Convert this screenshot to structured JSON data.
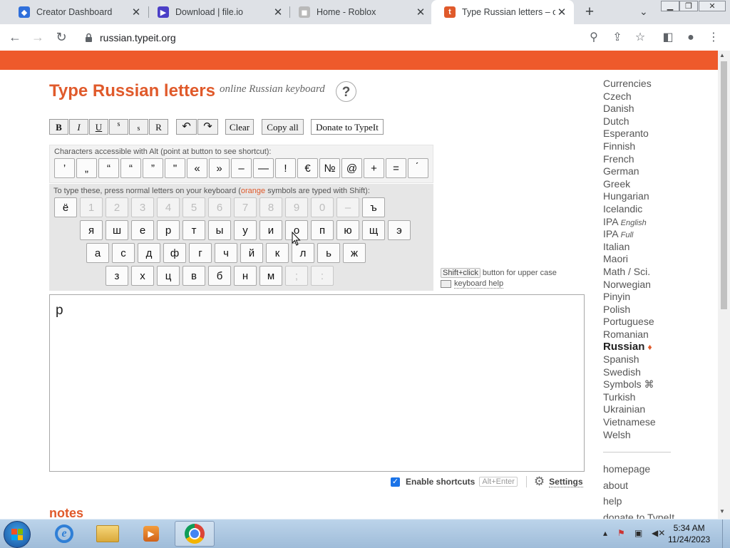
{
  "browser": {
    "tabs": [
      {
        "title": "Creator Dashboard",
        "favicon_color": "#2f6fdb"
      },
      {
        "title": "Download | file.io",
        "favicon_color": "#4b3fc7"
      },
      {
        "title": "Home - Roblox",
        "favicon_color": "#b9b9b9"
      },
      {
        "title": "Type Russian letters – onl",
        "favicon_color": "#e05a2b",
        "favicon_letter": "t"
      }
    ],
    "url": "russian.typeit.org",
    "new_tab_symbol": "+"
  },
  "page": {
    "title": "Type Russian letters",
    "subtitle": "online Russian keyboard",
    "help_symbol": "?",
    "format_buttons": [
      "B",
      "I",
      "U",
      "s",
      "s",
      "R"
    ],
    "undo_symbol": "↶",
    "redo_symbol": "↷",
    "clear_label": "Clear",
    "copy_all_label": "Copy all",
    "donate_label": "Donate to TypeIt",
    "alt_label": "Characters accessible with Alt (point at button to see shortcut):",
    "alt_keys": [
      "’",
      "„",
      "“",
      "“",
      "”",
      "\"",
      "«",
      "»",
      "–",
      "—",
      "!",
      "€",
      "№",
      "@",
      "+",
      "=",
      "́"
    ],
    "normal_label_pre": "To type these, press normal letters on your keyboard (",
    "normal_label_orange": "orange",
    "normal_label_post": " symbols are typed with Shift):",
    "row1": [
      "ё",
      "1",
      "2",
      "3",
      "4",
      "5",
      "6",
      "7",
      "8",
      "9",
      "0",
      "–",
      "ъ"
    ],
    "row2": [
      "я",
      "ш",
      "е",
      "р",
      "т",
      "ы",
      "у",
      "и",
      "о",
      "п",
      "ю",
      "щ",
      "э"
    ],
    "row3": [
      "а",
      "с",
      "д",
      "ф",
      "г",
      "ч",
      "й",
      "к",
      "л",
      "ь",
      "ж"
    ],
    "row4": [
      "з",
      "х",
      "ц",
      "в",
      "б",
      "н",
      "м",
      ";",
      ":"
    ],
    "shift_click": "Shift+click",
    "shift_hint_rest": " button for upper case",
    "keyboard_help": "keyboard help",
    "text_content": "р",
    "enable_shortcuts": "Enable shortcuts",
    "alt_enter": "Alt+Enter",
    "settings": "Settings",
    "notes_heading": "notes"
  },
  "sidebar": {
    "languages": [
      "Currencies",
      "Czech",
      "Danish",
      "Dutch",
      "Esperanto",
      "Finnish",
      "French",
      "German",
      "Greek",
      "Hungarian",
      "Icelandic"
    ],
    "ipa_english": "IPA",
    "ipa_english_small": "English",
    "ipa_full": "IPA",
    "ipa_full_small": "Full",
    "languages2": [
      "Italian",
      "Maori",
      "Math / Sci.",
      "Norwegian",
      "Pinyin",
      "Polish",
      "Portuguese",
      "Romanian"
    ],
    "current": "Russian",
    "current_mark": "♦",
    "languages3": [
      "Spanish",
      "Swedish"
    ],
    "symbols": "Symbols ⌘",
    "languages4": [
      "Turkish",
      "Ukrainian",
      "Vietnamese",
      "Welsh"
    ],
    "links": [
      "homepage",
      "about",
      "help",
      "donate to TypeIt"
    ]
  },
  "taskbar": {
    "time": "5:34 AM",
    "date": "11/24/2023"
  },
  "colors": {
    "accent": "#ee5a2b",
    "title": "#e05a2b"
  }
}
